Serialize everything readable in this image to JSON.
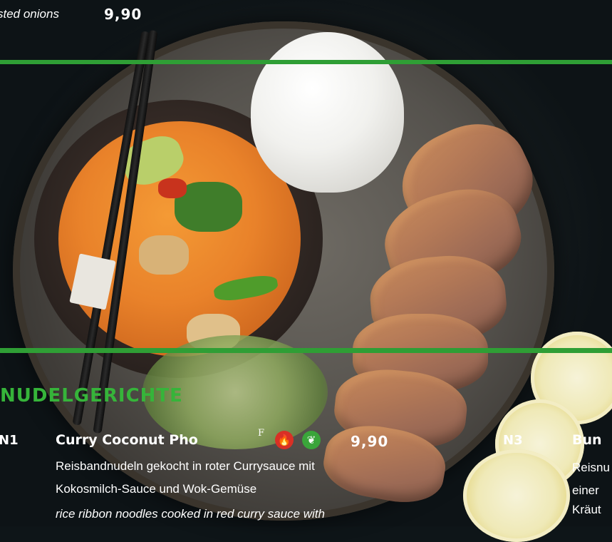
{
  "top_item": {
    "desc_fragment": "sted onions",
    "price": "9,90"
  },
  "section": {
    "title": "NUDELGERICHTE"
  },
  "dish_n1": {
    "code": "N1",
    "name": "Curry Coconut Pho",
    "footnote_mark": "F",
    "price": "9,90",
    "desc_de_line1": "Reisbandnudeln gekocht in roter Currysauce mit",
    "desc_de_line2": "Kokosmilch-Sauce und Wok-Gemüse",
    "desc_en_line1": "rice ribbon noodles cooked in red curry sauce with"
  },
  "dish_n3": {
    "code": "N3",
    "name_fragment": "Bun",
    "desc_line1": "Reisnu",
    "desc_line2": "einer",
    "desc_line3": "Kräut"
  },
  "icons": {
    "spicy": "flame-icon",
    "vegetarian": "leaf-icon"
  },
  "colors": {
    "accent_green": "#2f9e35",
    "section_green": "#36b43a",
    "spicy_red": "#d93025",
    "veg_green": "#3aa53a",
    "text": "#ffffff"
  }
}
